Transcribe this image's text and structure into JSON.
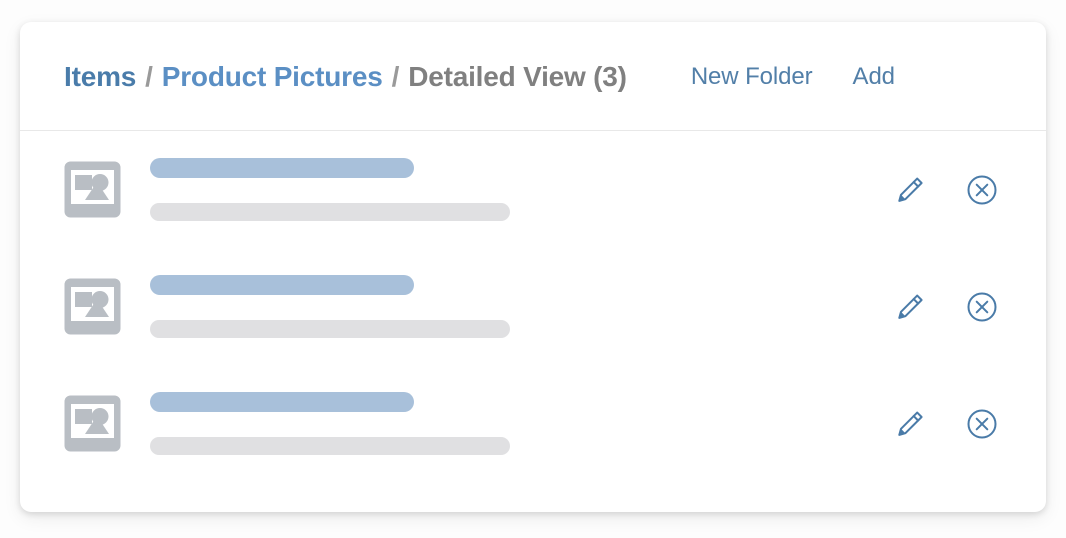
{
  "header": {
    "breadcrumb": [
      {
        "label": "Items",
        "state": "link"
      },
      {
        "label": "Product Pictures",
        "state": "link"
      },
      {
        "label": "Detailed View (3)",
        "state": "current"
      }
    ],
    "separator": "/",
    "actions": [
      {
        "label": "New Folder",
        "name": "new-folder-button"
      },
      {
        "label": "Add",
        "name": "add-button"
      }
    ]
  },
  "colors": {
    "crumb_items": "#4a7caa",
    "crumb_folder": "#5b8fc4",
    "crumb_current": "#808080",
    "separator": "#9a9a9a",
    "action_link": "#527fa8",
    "skeleton_title": "#a8c0da",
    "skeleton_subtitle": "#e0e0e2",
    "thumbnail": "#b9bec4",
    "icon_stroke": "#4a7ba8",
    "card_background": "#ffffff",
    "page_background": "#fdfdfd",
    "divider": "#e8e8e8"
  },
  "list": {
    "item_count": 3,
    "items": [
      {
        "thumbnail_icon": "image-placeholder-icon",
        "title_placeholder": "",
        "subtitle_placeholder": "",
        "edit_icon": "pencil-icon",
        "delete_icon": "circle-x-icon"
      },
      {
        "thumbnail_icon": "image-placeholder-icon",
        "title_placeholder": "",
        "subtitle_placeholder": "",
        "edit_icon": "pencil-icon",
        "delete_icon": "circle-x-icon"
      },
      {
        "thumbnail_icon": "image-placeholder-icon",
        "title_placeholder": "",
        "subtitle_placeholder": "",
        "edit_icon": "pencil-icon",
        "delete_icon": "circle-x-icon"
      }
    ]
  }
}
